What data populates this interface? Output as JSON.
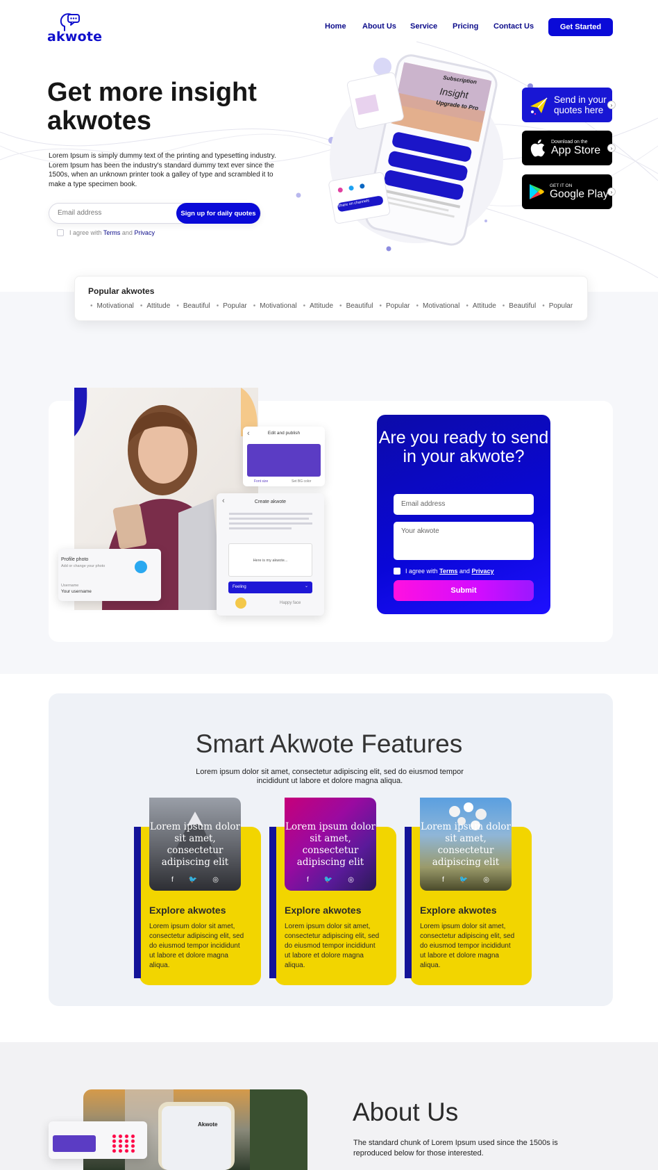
{
  "brand": {
    "name": "akwote",
    "color": "#1010cc"
  },
  "nav": {
    "items": [
      "Home",
      "About Us",
      "Service",
      "Pricing",
      "Contact Us"
    ],
    "cta": "Get Started"
  },
  "hero": {
    "title": "Get more insight akwotes",
    "description": "Lorem Ipsum is simply dummy text of the printing and typesetting industry. Lorem Ipsum has been the industry's standard dummy text ever since the 1500s, when an unknown printer took a galley of type and scrambled it to make a type specimen book.",
    "email_placeholder": "Email address",
    "signup_label": "Sign up for daily quotes",
    "agree_prefix": "I agree with",
    "agree_terms": "Terms",
    "agree_and": "and",
    "agree_privacy": "Privacy"
  },
  "phone": {
    "screen_title": "Subscription",
    "insight": "Insight",
    "upgrade": "Upgrade to Pro",
    "share": "Share on channels"
  },
  "stores": {
    "send_label": "Send in your quotes here",
    "appstore_small": "Download on the",
    "appstore_big": "App Store",
    "google_small": "GET IT ON",
    "google_big": "Google Play"
  },
  "popular": {
    "title": "Popular akwotes",
    "tags": [
      "Motivational",
      "Attitude",
      "Beautiful",
      "Popular",
      "Motivational",
      "Attitude",
      "Beautiful",
      "Popular",
      "Motivational",
      "Attitude",
      "Beautiful",
      "Popular"
    ]
  },
  "mockups": {
    "edit_title": "Edit and publish",
    "create_title": "Create akwote",
    "placeholder_here": "Here is my akwote...",
    "feeling": "Feeling",
    "happy_face": "Happy face",
    "profile_photo": "Profile photo",
    "profile_sub": "Add or change your photo",
    "username_label": "Username",
    "username_value": "Your username",
    "font_size": "Font size",
    "set_bg": "Set BG color"
  },
  "ready": {
    "title": "Are you ready to send in your akwote?",
    "email_placeholder": "Email address",
    "quote_placeholder": "Your akwote",
    "agree_prefix": "I agree with",
    "agree_terms": "Terms",
    "agree_and": "and",
    "agree_privacy": "Privacy",
    "submit": "Submit"
  },
  "features": {
    "title": "Smart Akwote Features",
    "description": "Lorem ipsum dolor sit amet, consectetur adipiscing elit, sed do eiusmod tempor incididunt ut labore et dolore magna aliqua.",
    "cards": [
      {
        "image_text": "Lorem ipsum dolor sit amet, consectetur adipiscing elit",
        "title": "Explore akwotes",
        "text": "Lorem ipsum dolor sit amet, consectetur adipiscing elit, sed do eiusmod tempor incididunt ut labore et dolore magna aliqua."
      },
      {
        "image_text": "Lorem ipsum dolor sit amet, consectetur adipiscing elit",
        "title": "Explore akwotes",
        "text": "Lorem ipsum dolor sit amet, consectetur adipiscing elit, sed do eiusmod tempor incididunt ut labore et dolore magna aliqua."
      },
      {
        "image_text": "Lorem ipsum dolor sit amet, consectetur adipiscing elit",
        "title": "Explore akwotes",
        "text": "Lorem ipsum dolor sit amet, consectetur adipiscing elit, sed do eiusmod tempor incididunt ut labore et dolore magna aliqua."
      }
    ]
  },
  "about": {
    "title": "About Us",
    "description": "The standard chunk of Lorem Ipsum used since the 1500s is reproduced below for those interested.",
    "app_name": "Akwote"
  },
  "colors": {
    "primary": "#0a0ad8",
    "accent_pink": "#ff10e0",
    "yellow": "#f2d500"
  }
}
